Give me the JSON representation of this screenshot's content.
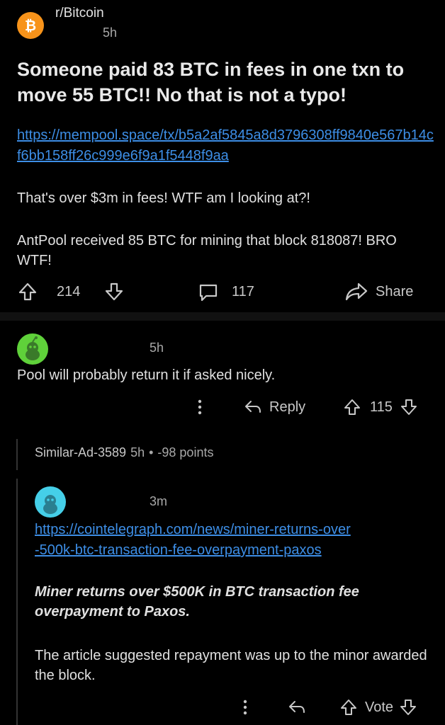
{
  "post": {
    "subreddit": "r/Bitcoin",
    "time": "5h",
    "title": "Someone paid 83 BTC in fees in one txn to move 55 BTC!! No that is not a typo!",
    "link": "https://mempool.space/tx/b5a2af5845a8d3796308ff9840e567b14cf6bb158ff26c999e6f9a1f5448f9aa",
    "paragraph1": "That's over $3m in fees! WTF am I looking at?!",
    "paragraph2": "AntPool received 85 BTC for mining that block 818087! BRO WTF!",
    "upvotes": "214",
    "comments": "117",
    "share_label": "Share"
  },
  "comment1": {
    "time": "5h",
    "text": "Pool will probably return it if asked nicely.",
    "reply_label": "Reply",
    "score": "115"
  },
  "collapsed_comment": {
    "author": "Similar-Ad-3589",
    "time": "5h",
    "separator": "•",
    "points": "-98 points"
  },
  "comment2": {
    "time": "3m",
    "link_line1": "https://cointelegraph.com/news/miner-returns-over",
    "link_line2": "-500k-btc-transaction-fee-overpayment-paxos",
    "headline": "Miner returns over $500K in BTC transaction fee overpayment to Paxos.",
    "text": "The article suggested repayment was up to the minor awarded the block.",
    "vote_label": "Vote"
  },
  "icons": {
    "subreddit": "bitcoin-icon",
    "upvote": "arrow-up-icon",
    "downvote": "arrow-down-icon",
    "comment": "speech-bubble-icon",
    "share": "share-arrow-icon",
    "more": "kebab-menu-icon",
    "reply": "reply-arrow-icon",
    "avatar": "snoo-avatar-icon"
  },
  "colors": {
    "background": "#000000",
    "link": "#3d8ee6",
    "bitcoin_orange": "#f7931a",
    "avatar1_green": "#5fd13a",
    "avatar2_cyan": "#45cfe8"
  }
}
